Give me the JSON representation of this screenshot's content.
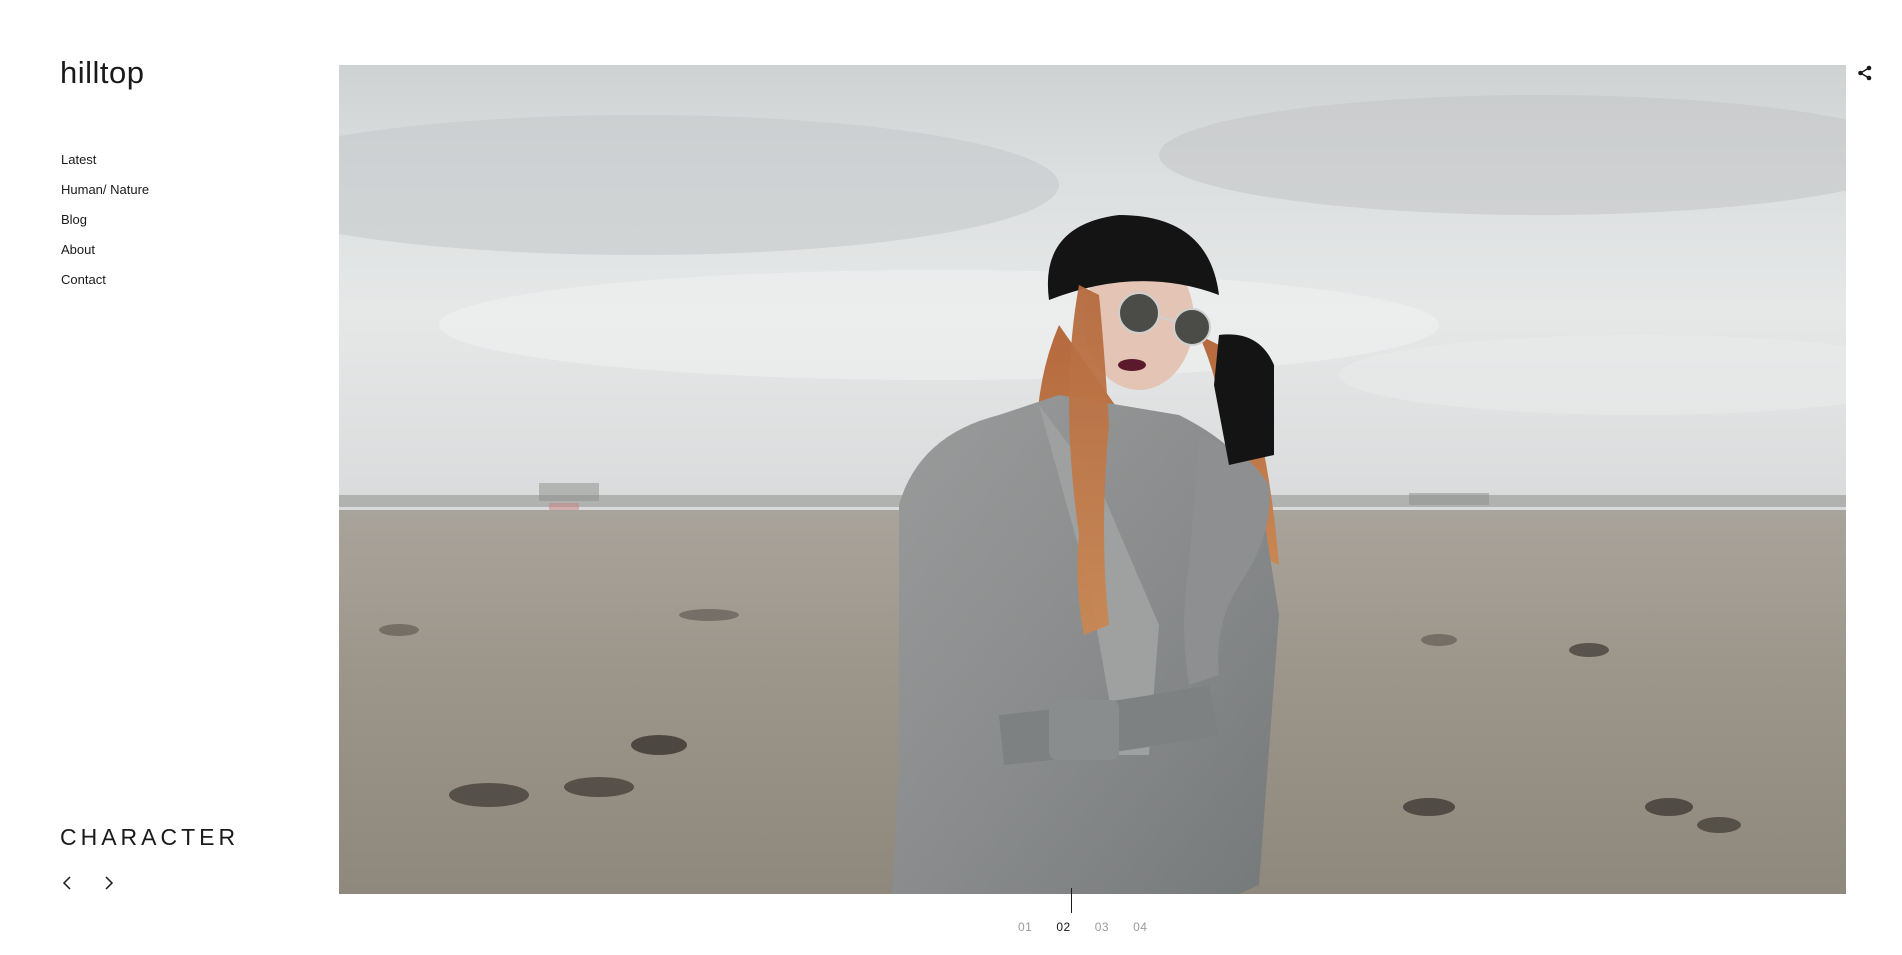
{
  "site": {
    "logo": "hilltop"
  },
  "nav": {
    "items": [
      {
        "label": "Latest"
      },
      {
        "label": "Human/ Nature"
      },
      {
        "label": "Blog"
      },
      {
        "label": "About"
      },
      {
        "label": "Contact"
      }
    ]
  },
  "gallery": {
    "title": "CHARACTER",
    "pages": [
      "01",
      "02",
      "03",
      "04"
    ],
    "active_page": "02",
    "image": {
      "subject": "woman in grey coat, black beret and sunglasses in a field"
    }
  },
  "icons": {
    "share": "share-icon",
    "prev": "chevron-left-icon",
    "next": "chevron-right-icon"
  },
  "colors": {
    "text": "#1a1a1a",
    "muted": "#9a9a9a",
    "background": "#ffffff"
  }
}
